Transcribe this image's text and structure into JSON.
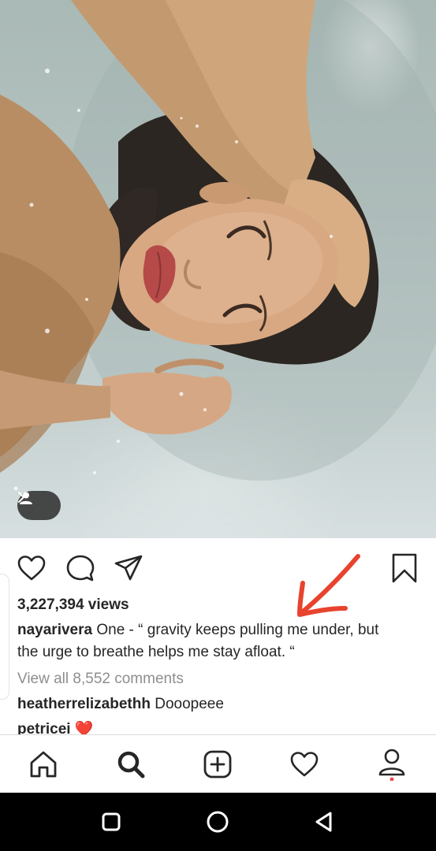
{
  "post": {
    "image_alt": "Woman floating in a bathtub of water",
    "views": "3,227,394 views",
    "caption_user": "nayarivera",
    "caption_line1": "One - “ gravity keeps pulling me under, but",
    "caption_line2": "the urge to breathe helps me stay afloat. “",
    "view_comments": "View all 8,552 comments",
    "comments": [
      {
        "user": "heatherrelizabethh",
        "text": "Dooopeee"
      },
      {
        "user": "petricei",
        "text": "❤️"
      }
    ]
  },
  "icons": {
    "tag": "user-tag-icon",
    "like": "heart-icon",
    "comment": "comment-icon",
    "share": "send-icon",
    "save": "bookmark-icon",
    "annotation": "red-arrow-annotation"
  },
  "bottom_nav": [
    "home-icon",
    "search-icon",
    "new-post-icon",
    "activity-icon",
    "profile-icon"
  ],
  "system_nav": [
    "recents-button",
    "home-button",
    "back-button"
  ],
  "colors": {
    "text": "#262626",
    "secondary": "#8e8e8e",
    "heart_red": "#ed4956",
    "annotation_red": "#e8432e",
    "system_bar": "#000000"
  }
}
